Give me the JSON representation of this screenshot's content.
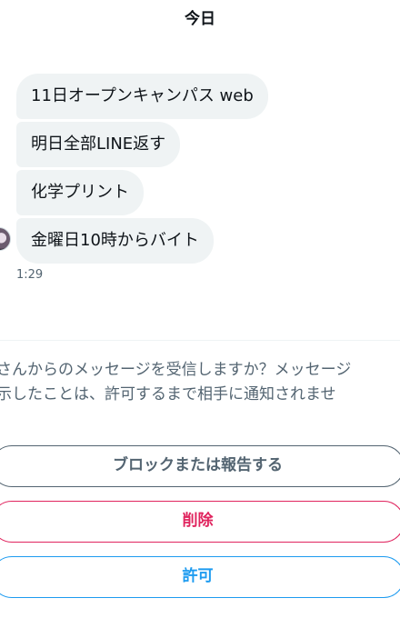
{
  "date_header": "今日",
  "messages": [
    {
      "text": "11日オープンキャンパス web"
    },
    {
      "text": "明日全部LINE返す"
    },
    {
      "text": "化学プリント"
    },
    {
      "text": "金曜日10時からバイト"
    }
  ],
  "timestamp": "1:29",
  "request": {
    "line1": "さんからのメッセージを受信しますか？メッセージ",
    "line2": "示したことは、許可するまで相手に通知されませ"
  },
  "actions": {
    "block_report": "ブロックまたは報告する",
    "delete": "削除",
    "allow": "許可"
  },
  "colors": {
    "bubble_bg": "#eff3f4",
    "secondary_text": "#536471",
    "delete_red": "#e0245e",
    "allow_blue": "#1d9bf0"
  }
}
